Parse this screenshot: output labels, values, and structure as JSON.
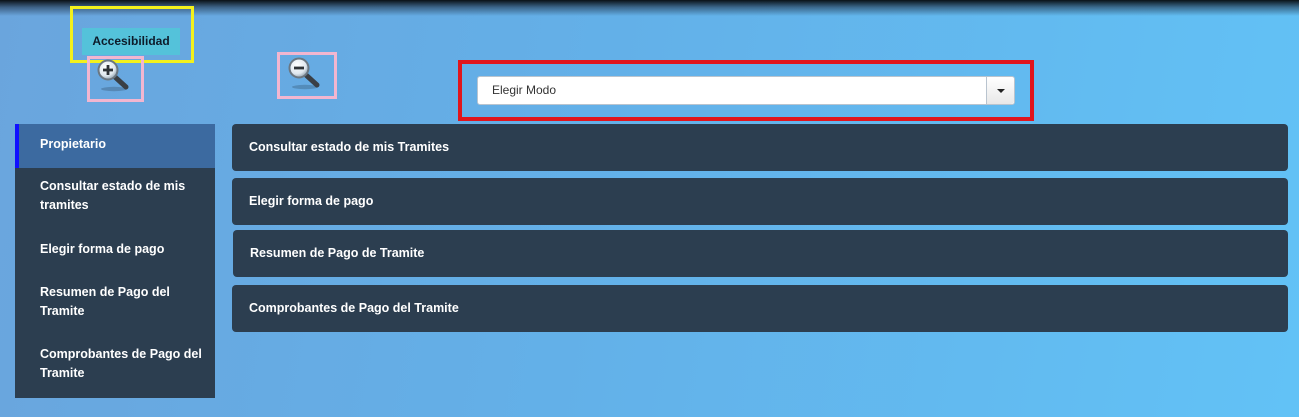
{
  "accessibility": {
    "label": "Accesibilidad"
  },
  "zoom": {
    "in_icon": "zoom-in-icon",
    "out_icon": "zoom-out-icon"
  },
  "mode_select": {
    "value": "Elegir Modo"
  },
  "sidebar": {
    "items": [
      {
        "label": "Propietario",
        "active": true
      },
      {
        "label": "Consultar estado de mis tramites"
      },
      {
        "label": "Elegir forma de pago"
      },
      {
        "label": "Resumen de Pago del Tramite"
      },
      {
        "label": "Comprobantes de Pago del Tramite"
      }
    ]
  },
  "panels": [
    {
      "label": "Consultar estado de mis Tramites"
    },
    {
      "label": "Elegir forma de pago"
    },
    {
      "label": "Resumen de Pago de Tramite"
    },
    {
      "label": "Comprobantes de Pago del Tramite"
    }
  ],
  "colors": {
    "panel_bg": "#2c3e50",
    "sidebar_active_bg": "#3c6aa0",
    "sidebar_active_border": "#1010ff",
    "accessibility_btn": "#54c2da",
    "highlight_yellow": "#f3f11c",
    "highlight_pink": "#f2b6d0",
    "highlight_red": "#e0151c"
  }
}
